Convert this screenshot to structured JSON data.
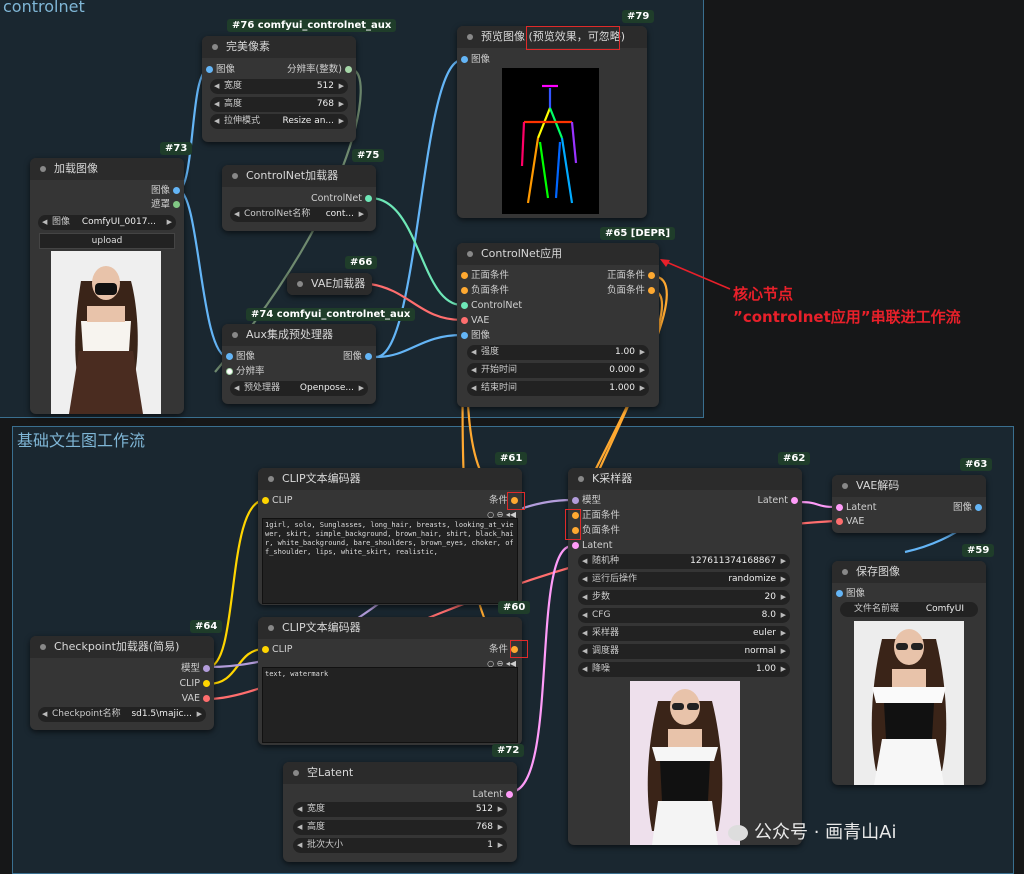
{
  "groups": {
    "controlnet": "controlnet",
    "txt2img": "基础文生图工作流"
  },
  "n76": {
    "badge": "#76 comfyui_controlnet_aux",
    "title": "完美像素",
    "in_image": "图像",
    "out_res": "分辨率(整数)",
    "w_width": {
      "label": "宽度",
      "value": "512"
    },
    "w_height": {
      "label": "高度",
      "value": "768"
    },
    "w_mode": {
      "label": "拉伸模式",
      "value": "Resize an..."
    }
  },
  "n73": {
    "badge": "#73",
    "title": "加载图像",
    "out_image": "图像",
    "out_mask": "遮罩",
    "w_image": {
      "label": "图像",
      "value": "ComfyUI_0017..."
    },
    "upload": "upload"
  },
  "n75": {
    "badge": "#75",
    "title": "ControlNet加载器",
    "out": "ControlNet",
    "w_name": {
      "label": "ControlNet名称",
      "value": "cont..."
    }
  },
  "n79": {
    "badge": "#79",
    "title": "预览图像",
    "note": "(预览效果，可忽略)",
    "in_image": "图像"
  },
  "n66": {
    "badge": "#66",
    "title": "VAE加载器"
  },
  "n74": {
    "badge": "#74 comfyui_controlnet_aux",
    "title": "Aux集成预处理器",
    "in_image": "图像",
    "in_res": "分辨率",
    "out_image": "图像",
    "w_pre": {
      "label": "预处理器",
      "value": "Openpose..."
    }
  },
  "n65": {
    "badge": "#65 [DEPR]",
    "title": "ControlNet应用",
    "in_pos": "正面条件",
    "in_neg": "负面条件",
    "in_cn": "ControlNet",
    "in_vae": "VAE",
    "in_image": "图像",
    "out_pos": "正面条件",
    "out_neg": "负面条件",
    "w_strength": {
      "label": "强度",
      "value": "1.00"
    },
    "w_start": {
      "label": "开始时间",
      "value": "0.000"
    },
    "w_end": {
      "label": "结束时间",
      "value": "1.000"
    }
  },
  "annotation": {
    "line1": "核心节点",
    "line2": "”controlnet应用”串联进工作流"
  },
  "n61": {
    "badge": "#61",
    "title": "CLIP文本编码器",
    "in_clip": "CLIP",
    "out": "条件",
    "text": "1girl, solo, Sunglasses, long_hair, breasts, looking_at_viewer, skirt, simple_background, brown_hair, shirt, black_hair, white_background, bare_shoulders, brown_eyes, choker, off_shoulder, lips, white_skirt, realistic,"
  },
  "n60": {
    "badge": "#60",
    "title": "CLIP文本编码器",
    "in_clip": "CLIP",
    "out": "条件",
    "text": "text, watermark"
  },
  "n62": {
    "badge": "#62",
    "title": "K采样器",
    "in_model": "模型",
    "in_pos": "正面条件",
    "in_neg": "负面条件",
    "in_latent": "Latent",
    "out": "Latent",
    "w_seed": {
      "label": "随机种",
      "value": "127611374168867"
    },
    "w_after": {
      "label": "运行后操作",
      "value": "randomize"
    },
    "w_steps": {
      "label": "步数",
      "value": "20"
    },
    "w_cfg": {
      "label": "CFG",
      "value": "8.0"
    },
    "w_sampler": {
      "label": "采样器",
      "value": "euler"
    },
    "w_sched": {
      "label": "调度器",
      "value": "normal"
    },
    "w_denoise": {
      "label": "降噪",
      "value": "1.00"
    }
  },
  "n63": {
    "badge": "#63",
    "title": "VAE解码",
    "in_latent": "Latent",
    "in_vae": "VAE",
    "out": "图像"
  },
  "n59": {
    "badge": "#59",
    "title": "保存图像",
    "in_image": "图像",
    "w_prefix": {
      "label": "文件名前缀",
      "value": "ComfyUI"
    }
  },
  "n64": {
    "badge": "#64",
    "title": "Checkpoint加载器(简易)",
    "out_model": "模型",
    "out_clip": "CLIP",
    "out_vae": "VAE",
    "w_ckpt": {
      "label": "Checkpoint名称",
      "value": "sd1.5\\majic..."
    }
  },
  "n72": {
    "badge": "#72",
    "title": "空Latent",
    "out": "Latent",
    "w_width": {
      "label": "宽度",
      "value": "512"
    },
    "w_height": {
      "label": "高度",
      "value": "768"
    },
    "w_batch": {
      "label": "批次大小",
      "value": "1"
    }
  },
  "watermark": "公众号 · 画青山Ai",
  "colors": {
    "image": "#64b5f6",
    "mask": "#81c784",
    "conditioning": "#ffa931",
    "clip": "#ffd500",
    "model": "#b39ddb",
    "vae": "#ff6e6e",
    "latent": "#ff9cf9",
    "controlnet": "#6ee7b7",
    "int": "#a5d6a7"
  }
}
